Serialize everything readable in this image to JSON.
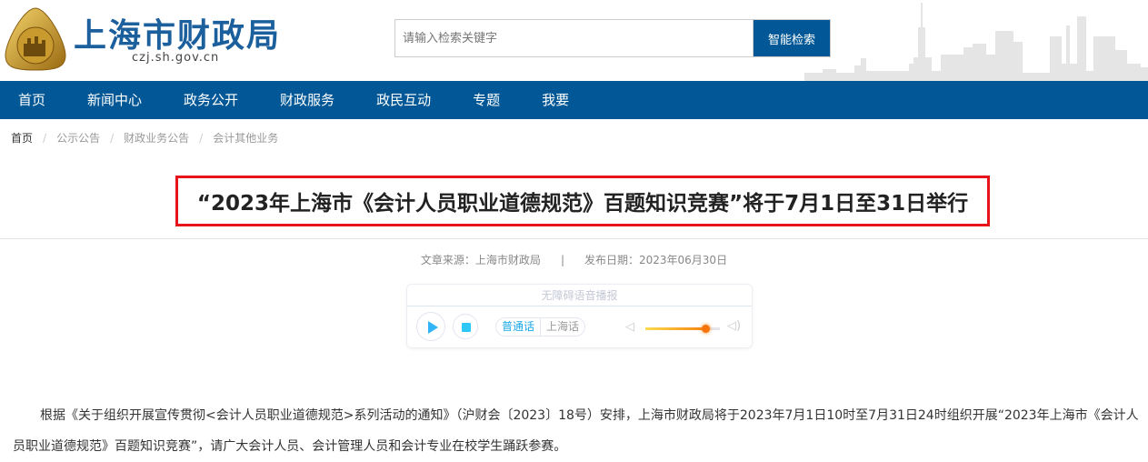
{
  "header": {
    "site_name": "上海市财政局",
    "site_url": "czj.sh.gov.cn",
    "search_placeholder": "请输入检索关键字",
    "search_button": "智能检索"
  },
  "nav": [
    "首页",
    "新闻中心",
    "政务公开",
    "财政服务",
    "政民互动",
    "专题",
    "我要"
  ],
  "breadcrumb": [
    "首页",
    "公示公告",
    "财政业务公告",
    "会计其他业务"
  ],
  "article": {
    "title": "“2023年上海市《会计人员职业道德规范》百题知识竞赛”将于7月1日至31日举行",
    "source": "文章来源：上海市财政局",
    "separator": "|",
    "date": "发布日期：2023年06月30日",
    "body": "根据《关于组织开展宣传贯彻<会计人员职业道德规范>系列活动的通知》（沪财会〔2023〕18号）安排，上海市财政局将于2023年7月1日10时至7月31日24时组织开展“2023年上海市《会计人员职业道德规范》百题知识竞赛”，请广大会计人员、会计管理人员和会计专业在校学生踊跃参赛。"
  },
  "audio": {
    "title": "无障碍语音播报",
    "lang_mandarin": "普通话",
    "lang_shanghai": "上海话",
    "volume": 0.8
  },
  "colors": {
    "nav": "#025896",
    "title_border": "#e8141b",
    "accent": "#1aa8e8"
  }
}
